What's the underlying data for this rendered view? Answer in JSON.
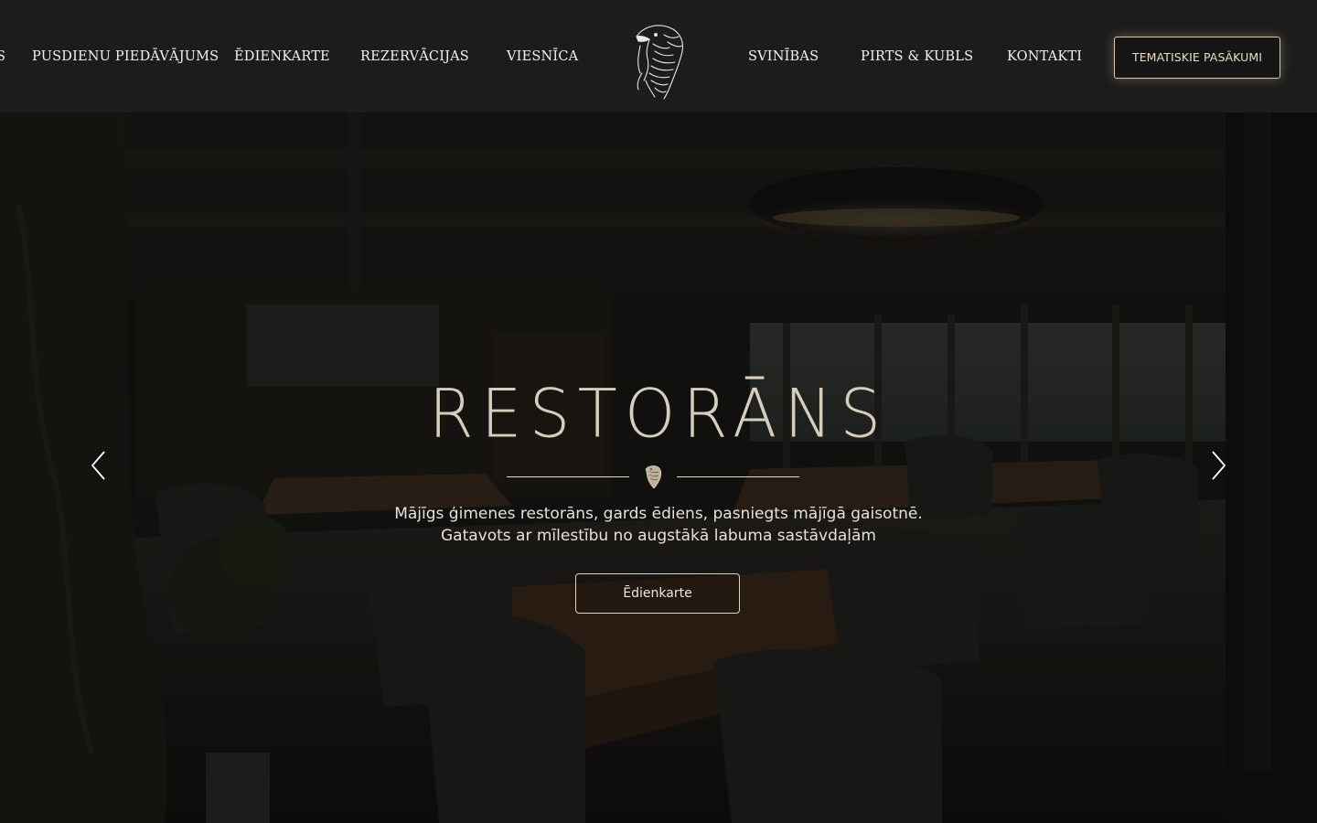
{
  "nav": {
    "left_items": [
      {
        "label": "S"
      },
      {
        "label": "PUSDIENU PIEDĀVĀJUMS"
      },
      {
        "label": "ĒDIENKARTE"
      },
      {
        "label": "REZERVĀCIJAS"
      },
      {
        "label": "VIESNĪCA"
      }
    ],
    "right_items": [
      {
        "label": "SVINĪBAS"
      },
      {
        "label": "PIRTS & KUBLS"
      },
      {
        "label": "KONTAKTI"
      }
    ],
    "cta_label": "TEMATISKIE PASĀKUMI",
    "logo_icon": "eagle-head-icon"
  },
  "hero": {
    "title": "RESTORĀNS",
    "subtitle_line1": "Mājīgs ģimenes restorāns, gards ēdiens, pasniegts mājīgā gaisotnē.",
    "subtitle_line2": "Gatavots ar mīlestību no augstākā labuma sastāvdaļām",
    "button_label": "Ēdienkarte",
    "prev_icon": "chevron-left-icon",
    "next_icon": "chevron-right-icon",
    "background_image": "restaurant-interior-photo"
  },
  "colors": {
    "header_bg": "#1c1c1c",
    "accent_gold": "#d8c8ad",
    "title_color": "#d8cdbd",
    "nav_text": "#f2f2f2"
  }
}
